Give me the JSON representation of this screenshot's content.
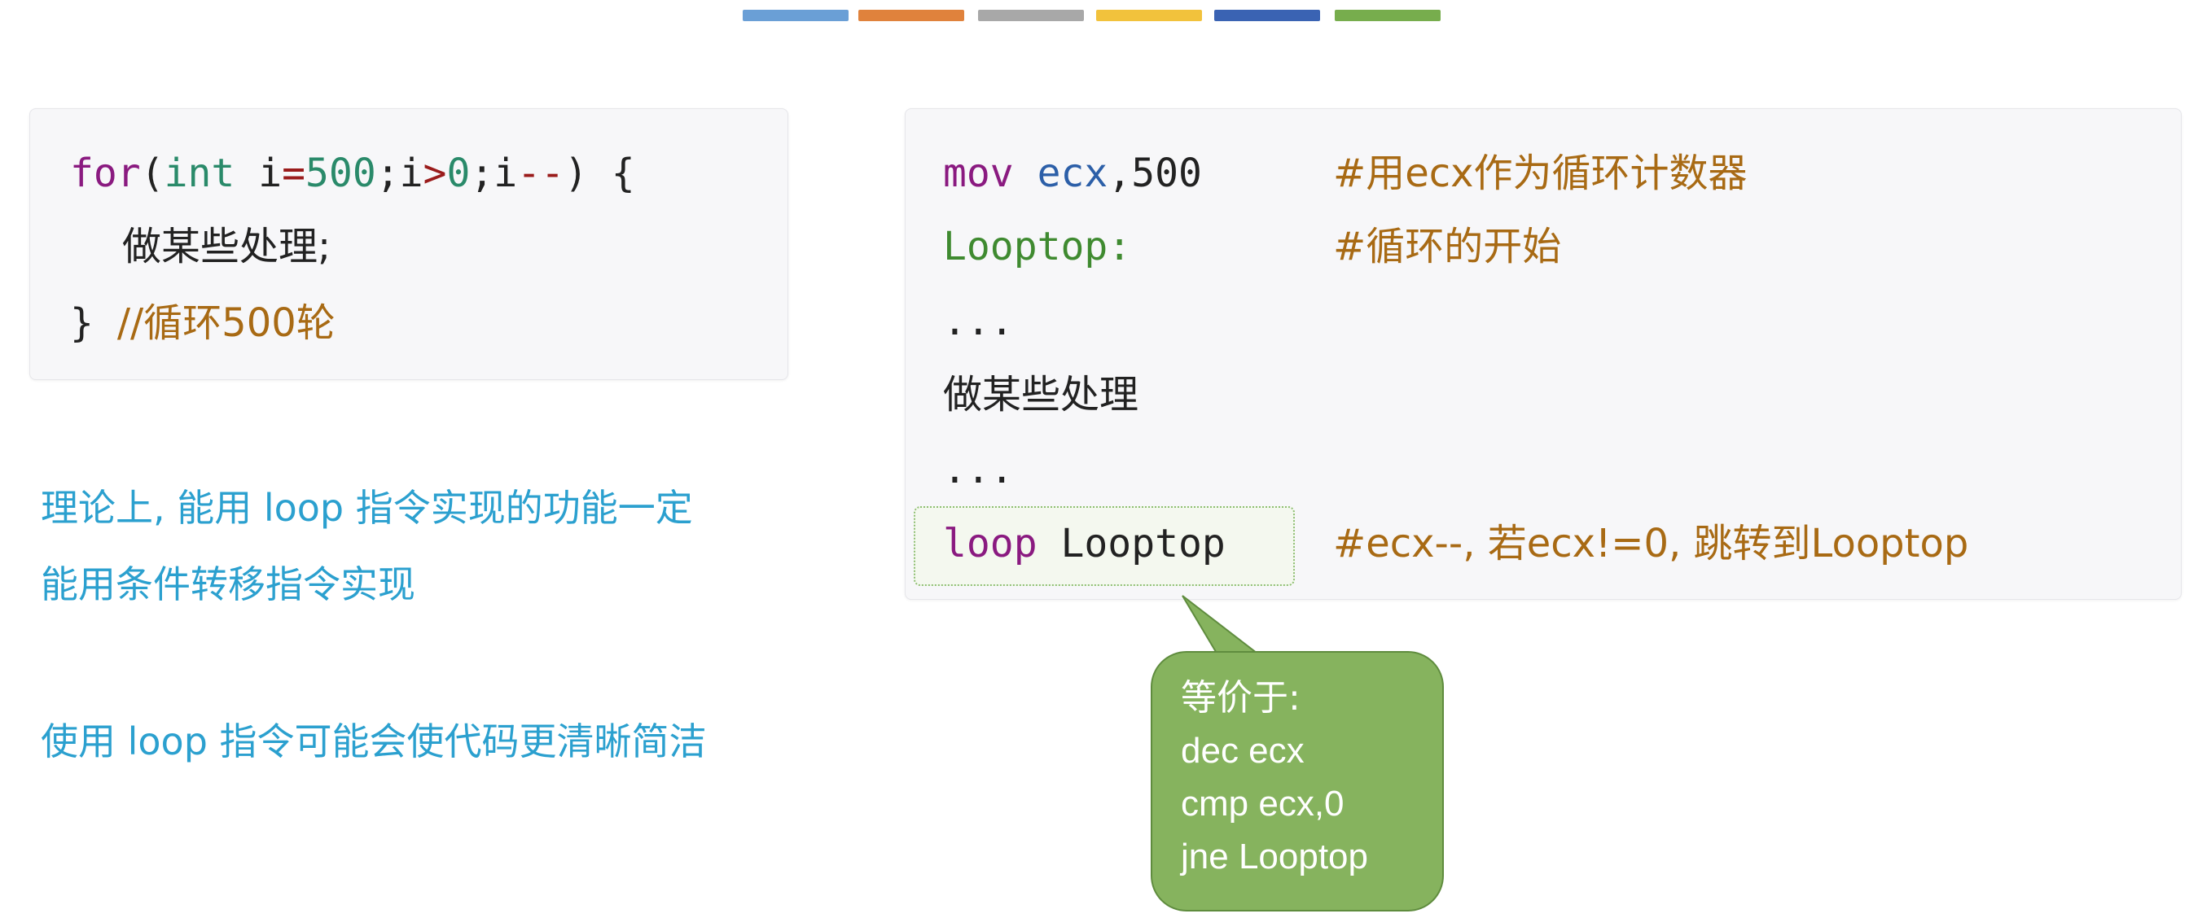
{
  "header_strips": {
    "colors": [
      "#6a9fd6",
      "#e0823c",
      "#a8a8a8",
      "#f2c23c",
      "#3a63b3",
      "#77ad4d"
    ]
  },
  "left_code": {
    "line1": {
      "for": "for",
      "paren_open": "(",
      "int": "int",
      "space": " ",
      "var": "i",
      "eq": "=",
      "n500": "500",
      "semi1": ";",
      "i2": "i",
      "gt": ">",
      "zero": "0",
      "semi2": ";",
      "i3": "i",
      "dec": "--",
      "paren_close": ")",
      "brace": " {"
    },
    "line2": "做某些处理;",
    "line3": {
      "brace": "}",
      "comment": "//循环500轮"
    }
  },
  "right_code": {
    "line1": {
      "mov": "mov",
      "ecx": "ecx",
      "rest": ",500",
      "comment": "#用ecx作为循环计数器"
    },
    "line2": {
      "label": "Looptop:",
      "comment": "#循环的开始"
    },
    "line3": "...",
    "line4": "做某些处理",
    "line5": "...",
    "line6": {
      "loop": "loop",
      "target": "Looptop",
      "comment": "#ecx--, 若ecx!=0, 跳转到Looptop"
    }
  },
  "notes": {
    "note1_line1": "理论上, 能用 loop 指令实现的功能一定",
    "note1_line2": "能用条件转移指令实现",
    "note2": "使用 loop 指令可能会使代码更清晰简洁"
  },
  "callout": {
    "line1": "等价于:",
    "line2": "dec ecx",
    "line3": "cmp ecx,0",
    "line4": "jne Looptop"
  }
}
